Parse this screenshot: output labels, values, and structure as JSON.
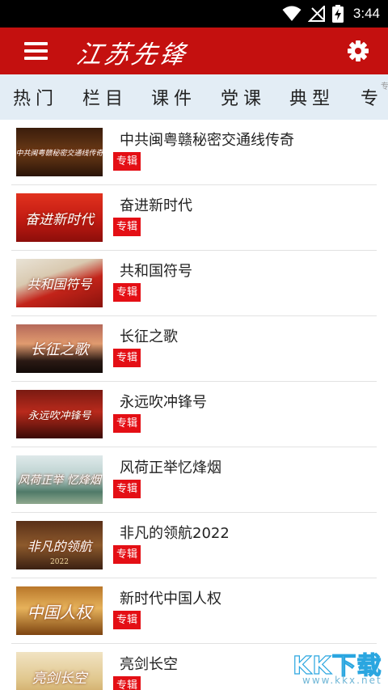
{
  "status_bar": {
    "time": "3:44",
    "icons": [
      "wifi-icon",
      "signal-off-icon",
      "battery-charging-icon"
    ]
  },
  "header": {
    "logo_text": "江苏先锋",
    "menu_icon": "hamburger-menu-icon",
    "settings_icon": "gear-icon",
    "background_color": "#c4100f"
  },
  "tabs": [
    {
      "label": "热门"
    },
    {
      "label": "栏目"
    },
    {
      "label": "课件"
    },
    {
      "label": "党课"
    },
    {
      "label": "典型"
    },
    {
      "label": "专"
    }
  ],
  "tab_overflow_label": "专题",
  "list": {
    "badge_label": "专辑",
    "items": [
      {
        "title": "中共闽粤赣秘密交通线传奇",
        "thumb_text": "中共闽粤赣秘密交通线传奇",
        "thumb_theme": "dark-brown"
      },
      {
        "title": "奋进新时代",
        "thumb_text": "奋进新时代",
        "thumb_theme": "red"
      },
      {
        "title": "共和国符号",
        "thumb_text": "共和国符号",
        "thumb_theme": "red-flag"
      },
      {
        "title": "长征之歌",
        "thumb_text": "长征之歌",
        "thumb_theme": "sunset"
      },
      {
        "title": "永远吹冲锋号",
        "thumb_text": "永远吹冲锋号",
        "thumb_theme": "dark-red"
      },
      {
        "title": "风荷正举忆烽烟",
        "thumb_text": "风荷正举 忆烽烟",
        "thumb_theme": "lotus"
      },
      {
        "title": "非凡的领航2022",
        "thumb_text": "非凡的领航",
        "thumb_sub": "2022",
        "thumb_theme": "bronze"
      },
      {
        "title": "新时代中国人权",
        "thumb_text": "中国人权",
        "thumb_theme": "gold"
      },
      {
        "title": "亮剑长空",
        "thumb_text": "亮剑长空",
        "thumb_theme": "beige"
      }
    ]
  },
  "watermark": {
    "main": "KK下载",
    "sub": "www.kkx.net"
  },
  "colors": {
    "badge": "#e40f15",
    "tab_bar": "#e3edf5",
    "watermark_accent": "#2aa6e0"
  }
}
